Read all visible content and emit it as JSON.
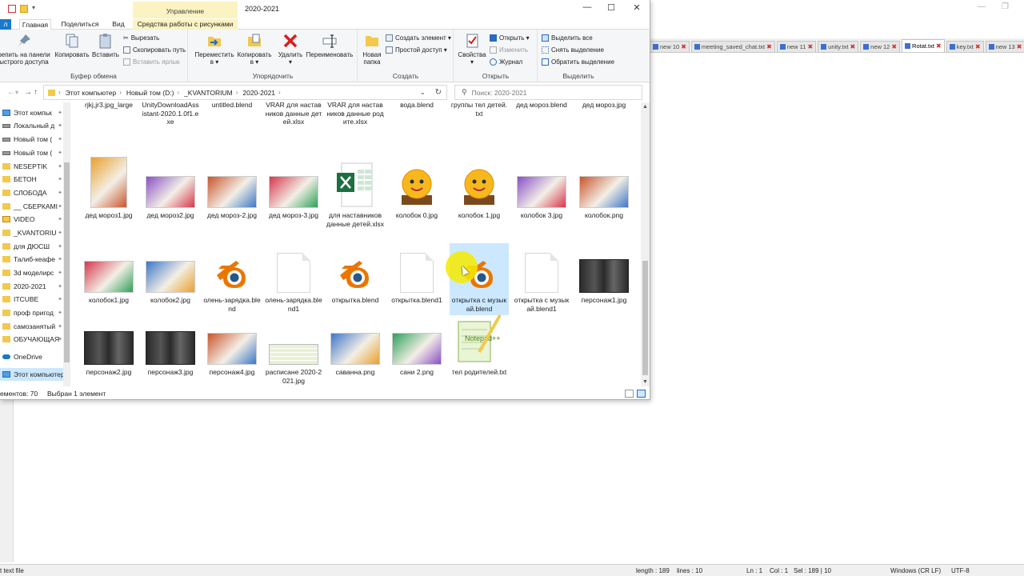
{
  "notepad": {
    "tabs": [
      "new 10",
      "meeting_saved_chat.txt",
      "new 11",
      "unity.txt",
      "new 12",
      "Rotat.txt",
      "key.txt",
      "new 13"
    ],
    "active_tab": "Rotat.txt",
    "status": {
      "type": "t text file",
      "length": "length : 189",
      "lines": "lines : 10",
      "ln": "Ln : 1",
      "col": "Col : 1",
      "sel": "Sel : 189 | 10",
      "eol": "Windows (CR LF)",
      "encoding": "UTF-8"
    }
  },
  "explorer": {
    "context_group": "Управление",
    "window_title": "2020-2021",
    "window_controls": {
      "minimize": "—",
      "maximize": "☐",
      "close": "✕"
    },
    "tabs": {
      "file": "л",
      "home": "Главная",
      "share": "Поделиться",
      "view": "Вид",
      "picture_tools": "Средства работы с рисунками"
    },
    "ribbon": {
      "clipboard": {
        "label": "Буфер обмена",
        "pin": "репить на панели\nыстрого доступа",
        "copy": "Копировать",
        "paste": "Вставить",
        "cut": "Вырезать",
        "copy_path": "Скопировать путь",
        "paste_shortcut": "Вставить ярлык"
      },
      "organize": {
        "label": "Упорядочить",
        "move": "Переместить\nв ▾",
        "copy_to": "Копировать\nв ▾",
        "delete": "Удалить\n▾",
        "rename": "Переименовать"
      },
      "create": {
        "label": "Создать",
        "new_folder": "Новая\nпапка",
        "new_item": "Создать элемент ▾",
        "easy_access": "Простой доступ ▾"
      },
      "open": {
        "label": "Открыть",
        "properties": "Свойства\n▾",
        "open": "Открыть ▾",
        "edit": "Изменить",
        "history": "Журнал"
      },
      "select": {
        "label": "Выделить",
        "select_all": "Выделить все",
        "select_none": "Снять выделение",
        "invert": "Обратить выделение"
      }
    },
    "address": {
      "crumbs": [
        "Этот компьютер",
        "Новый том (D:)",
        "_KVANTORIUM",
        "2020-2021"
      ],
      "search_placeholder": "Поиск: 2020-2021"
    },
    "nav_items": [
      {
        "label": "Этот компьк",
        "icon": "computer"
      },
      {
        "label": "Локальный д",
        "icon": "drive"
      },
      {
        "label": "Новый том (",
        "icon": "drive"
      },
      {
        "label": "Новый том (",
        "icon": "drive"
      },
      {
        "label": "NESEPTIK",
        "icon": "folder"
      },
      {
        "label": "БЕТОН",
        "icon": "folder"
      },
      {
        "label": "СЛОБОДА",
        "icon": "folder"
      },
      {
        "label": "__ СБЕРКАМІ",
        "icon": "folder"
      },
      {
        "label": "VIDEO",
        "icon": "video"
      },
      {
        "label": "_KVANTORIU",
        "icon": "folder"
      },
      {
        "label": "для ДЮСШ",
        "icon": "folder"
      },
      {
        "label": "Талиб-кеафе",
        "icon": "folder"
      },
      {
        "label": "3d моделирс",
        "icon": "folder"
      },
      {
        "label": "2020-2021",
        "icon": "folder"
      },
      {
        "label": "ITCUBE",
        "icon": "folder"
      },
      {
        "label": "проф пригод",
        "icon": "folder"
      },
      {
        "label": "самозанятый",
        "icon": "folder"
      },
      {
        "label": "ОБУЧАЮЩАЯ",
        "icon": "folder"
      },
      {
        "label": "OneDrive",
        "icon": "cloud"
      },
      {
        "label": "Этот компьютер",
        "icon": "computer"
      }
    ],
    "files": [
      {
        "name": "rjkj,jr3.jpg_large",
        "kind": "doc"
      },
      {
        "name": "UnityDownloadAssistant-2020.1.0f1.exe",
        "kind": "exe"
      },
      {
        "name": "untitled.blend",
        "kind": "blend"
      },
      {
        "name": "VRAR для наставников данные детей.xlsx",
        "kind": "xlsx"
      },
      {
        "name": "VRAR для наставников данные родите.xlsx",
        "kind": "xlsx"
      },
      {
        "name": "вода.blend",
        "kind": "blend"
      },
      {
        "name": "группы тел детей.txt",
        "kind": "txtimg"
      },
      {
        "name": "дед мороз.blend",
        "kind": "blend"
      },
      {
        "name": "дед мороз.jpg",
        "kind": "img"
      },
      {
        "name": "дед мороз1.jpg",
        "kind": "img"
      },
      {
        "name": "дед мороз2.jpg",
        "kind": "img"
      },
      {
        "name": "дед мороз-2.jpg",
        "kind": "img"
      },
      {
        "name": "дед мороз-3.jpg",
        "kind": "img"
      },
      {
        "name": "для наставников данные детей.xlsx",
        "kind": "xlsx"
      },
      {
        "name": "колобок 0.jpg",
        "kind": "kolobok"
      },
      {
        "name": "колобок 1.jpg",
        "kind": "kolobok"
      },
      {
        "name": "колобок 3.jpg",
        "kind": "img"
      },
      {
        "name": "колобок.png",
        "kind": "img"
      },
      {
        "name": "колобок1.jpg",
        "kind": "img"
      },
      {
        "name": "колобок2.jpg",
        "kind": "img"
      },
      {
        "name": "олень-зарядка.blend",
        "kind": "blend"
      },
      {
        "name": "олень-зарядка.blend1",
        "kind": "doc"
      },
      {
        "name": "открытка.blend",
        "kind": "blend"
      },
      {
        "name": "открытка.blend1",
        "kind": "doc"
      },
      {
        "name": "открытка с музыкай.blend",
        "kind": "blend"
      },
      {
        "name": "открытка с музыкай.blend1",
        "kind": "doc"
      },
      {
        "name": "персонаж1.jpg",
        "kind": "dark"
      },
      {
        "name": "персонаж2.jpg",
        "kind": "dark"
      },
      {
        "name": "персонаж3.jpg",
        "kind": "dark"
      },
      {
        "name": "персонаж4.jpg",
        "kind": "img"
      },
      {
        "name": "расписане 2020-2021.jpg",
        "kind": "table"
      },
      {
        "name": "саванна.png",
        "kind": "img"
      },
      {
        "name": "сани 2.png",
        "kind": "img"
      },
      {
        "name": "тел родителей.txt",
        "kind": "notepad"
      }
    ],
    "selected_file": "открытка с музыкай.blend",
    "status": {
      "count": "ементов: 70",
      "selected": "Выбран 1 элемент"
    }
  },
  "colors": {
    "selection": "#cce8ff",
    "context_tab": "#fbf3c2",
    "accent": "#1979ca",
    "blender_orange": "#ea7600",
    "blender_blue": "#265787",
    "excel_green": "#1d6f42",
    "cursor_highlight": "#f5ea00"
  }
}
